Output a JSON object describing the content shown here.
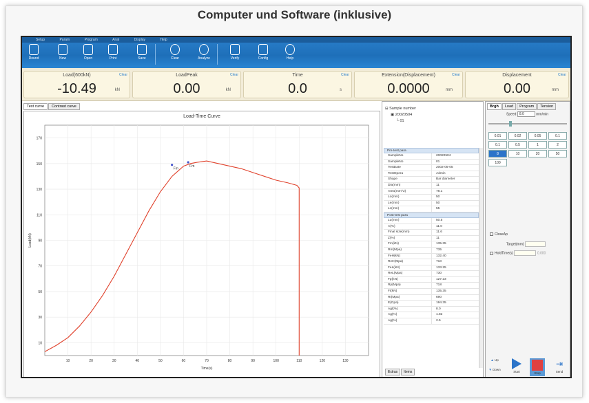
{
  "page_title": "Computer und Software (inklusive)",
  "menu": [
    "Setup",
    "Param",
    "Program",
    "Anal",
    "Display",
    "Help"
  ],
  "toolbar": [
    {
      "label": "Round",
      "icon": "grid-icon"
    },
    {
      "label": "New",
      "icon": "new-file-icon"
    },
    {
      "label": "Open",
      "icon": "open-icon"
    },
    {
      "label": "Print",
      "icon": "print-icon"
    },
    {
      "label": "Save",
      "icon": "save-icon"
    },
    {
      "label": "Clear",
      "icon": "clear-icon"
    },
    {
      "label": "Analyze",
      "icon": "pie-chart-icon"
    },
    {
      "label": "Verify",
      "icon": "verify-icon"
    },
    {
      "label": "Config",
      "icon": "tools-icon"
    },
    {
      "label": "Help",
      "icon": "help-icon"
    }
  ],
  "readouts": [
    {
      "label": "Load(600kN)",
      "value": "-10.49",
      "unit": "kN",
      "clear": "Clear"
    },
    {
      "label": "LoadPeak",
      "value": "0.00",
      "unit": "kN",
      "clear": "Clear"
    },
    {
      "label": "Time",
      "value": "0.0",
      "unit": "s",
      "clear": "Clear"
    },
    {
      "label": "Extension(Displacement)",
      "value": "0.0000",
      "unit": "mm",
      "clear": "Clear"
    },
    {
      "label": "Displacement",
      "value": "0.00",
      "unit": "mm",
      "clear": "Clear"
    }
  ],
  "chart_tabs": [
    "Test curve",
    "Contrast curve"
  ],
  "chart_data": {
    "type": "line",
    "title": "Load-Time Curve",
    "xlabel": "Time(s)",
    "ylabel": "Load(kN)",
    "xlim": [
      0,
      140
    ],
    "ylim": [
      0,
      180
    ],
    "x_ticks": [
      10,
      20,
      30,
      40,
      50,
      60,
      70,
      80,
      90,
      100,
      110,
      120,
      130
    ],
    "y_ticks": [
      10,
      30,
      50,
      70,
      90,
      110,
      130,
      150,
      170
    ],
    "series": [
      {
        "color": "#e0412b",
        "x": [
          0,
          5,
          10,
          15,
          20,
          25,
          30,
          35,
          40,
          45,
          50,
          55,
          60,
          63,
          66,
          70,
          75,
          80,
          85,
          90,
          95,
          100,
          105,
          109,
          110,
          110
        ],
        "y": [
          3,
          8,
          14,
          23,
          34,
          47,
          62,
          79,
          96,
          113,
          128,
          140,
          148,
          150,
          151,
          152,
          150,
          148,
          146,
          143,
          140,
          137,
          135,
          133,
          131,
          0
        ]
      }
    ],
    "annotations": [
      {
        "text": "Fm",
        "x": 55,
        "y": 149
      },
      {
        "text": "Fm",
        "x": 62,
        "y": 151
      }
    ],
    "grid": true
  },
  "tree": {
    "root": "Sample number",
    "child": "20020504",
    "leaf": "01"
  },
  "pre_params": {
    "header": "Pre-test para",
    "rows": [
      [
        "SampleNo",
        "20020504"
      ],
      [
        "SampleNo",
        "01"
      ],
      [
        "TestDate",
        "2002-05-05"
      ],
      [
        "TestOpera",
        "Admin"
      ],
      [
        "Shape",
        "Bar diameter"
      ],
      [
        "Dia(mm)",
        "11"
      ],
      [
        "Area(mm^2)",
        "78.1"
      ],
      [
        "Lo(mm)",
        "50"
      ],
      [
        "Le(mm)",
        "50"
      ],
      [
        "Lc(mm)",
        "55"
      ]
    ]
  },
  "post_params": {
    "header": "Post-test para",
    "rows": [
      [
        "Lu(mm)",
        "50.5"
      ],
      [
        "A(%)",
        "11.0"
      ],
      [
        "Final size(mm)",
        "11.6"
      ],
      [
        "Z(%)",
        "11"
      ],
      [
        "Fm(kN)",
        "135.35"
      ],
      [
        "Rm(Mpa)",
        "735"
      ],
      [
        "FeH(kN)",
        "132.40"
      ],
      [
        "ReH(Mpa)",
        "710"
      ],
      [
        "FeL(kN)",
        "133.25"
      ],
      [
        "ReL(Mpa)",
        "730"
      ],
      [
        "Fp(kN)",
        "127.23"
      ],
      [
        "Rp(Mpa)",
        "718"
      ],
      [
        "Ft(kN)",
        "135.35"
      ],
      [
        "Rt(Mpa)",
        "690"
      ],
      [
        "E(Gpa)",
        "194.35"
      ],
      [
        "Agt(%)",
        "8.0"
      ],
      [
        "Ag(%)",
        "1.82"
      ],
      [
        "Ag(%)",
        "2.5"
      ]
    ]
  },
  "mid_tabs": [
    "Extras",
    "Items"
  ],
  "right_tabs": [
    "Brgh",
    "Load",
    "Program",
    "Tension"
  ],
  "speed": {
    "label": "Speed",
    "value": "8.0",
    "unit": "mm/min"
  },
  "speed_buttons": [
    {
      "label": "0.01",
      "selected": false
    },
    {
      "label": "0.02",
      "selected": false
    },
    {
      "label": "0.05",
      "selected": false
    },
    {
      "label": "0.1",
      "selected": false
    },
    {
      "label": "0.1",
      "selected": false
    },
    {
      "label": "0.5",
      "selected": false
    },
    {
      "label": "1",
      "selected": false
    },
    {
      "label": "2",
      "selected": false
    },
    {
      "label": "8",
      "selected": true
    },
    {
      "label": "10",
      "selected": false
    },
    {
      "label": "20",
      "selected": false
    },
    {
      "label": "50",
      "selected": false
    },
    {
      "label": "100",
      "selected": false
    }
  ],
  "close_ap": "CloseAp",
  "target_label": "Target(mm)",
  "hold_label": "HoldTime(s)",
  "hold_value": "0.000",
  "bottom_buttons": [
    {
      "label": "Up",
      "icon": "up-arrow-icon"
    },
    {
      "label": "Down",
      "icon": "down-arrow-icon"
    },
    {
      "label": "Start",
      "icon": "play-icon"
    },
    {
      "label": "Stop",
      "icon": "stop-icon"
    },
    {
      "label": "Send",
      "icon": "send-icon"
    }
  ],
  "colors": {
    "ribbon": "#1e6fb9",
    "readout_bg": "#fbf6e2",
    "curve": "#e0412b",
    "stop": "#e04040",
    "start": "#2b74c9"
  }
}
